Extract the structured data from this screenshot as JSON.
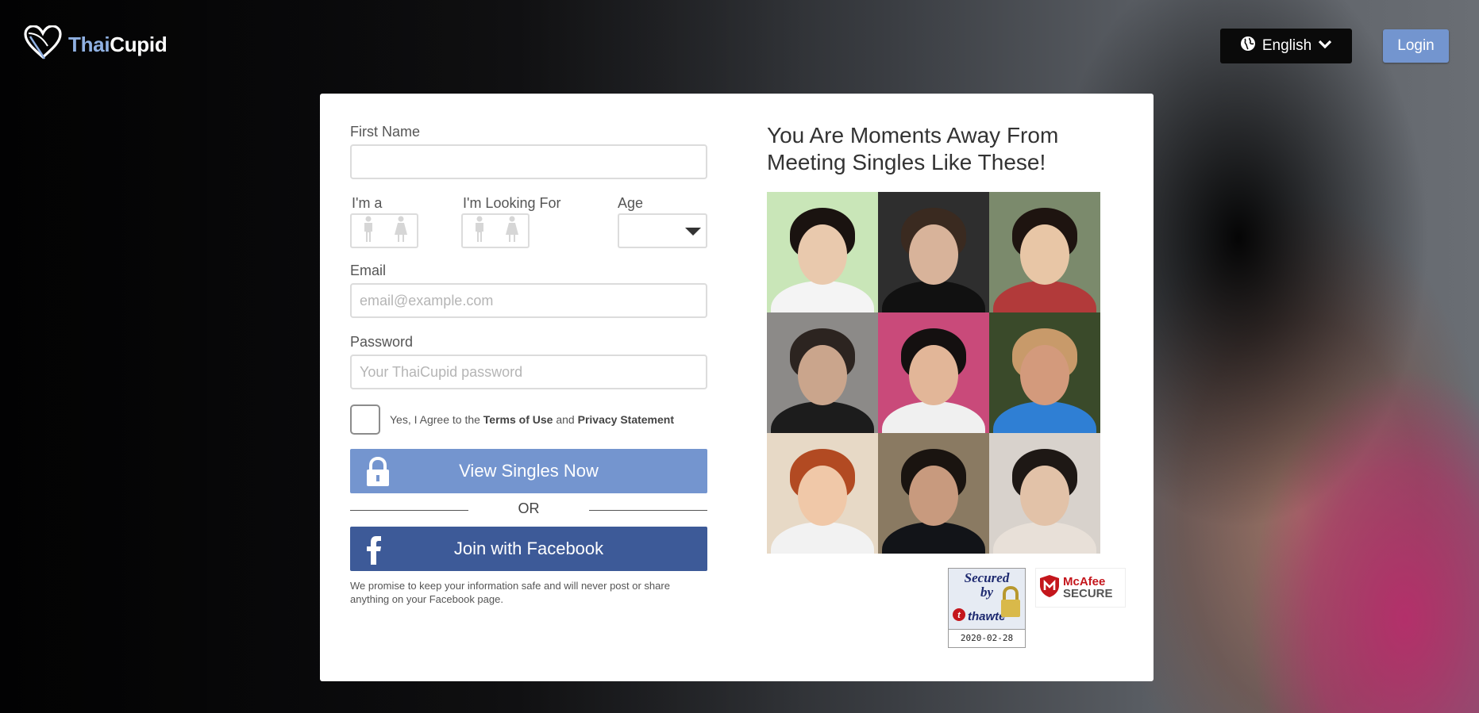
{
  "header": {
    "logo_part1": "Thai",
    "logo_part2": "Cupid",
    "language_label": "English",
    "login_label": "Login"
  },
  "form": {
    "first_name_label": "First Name",
    "first_name_value": "",
    "im_a_label": "I'm a",
    "looking_for_label": "I'm Looking For",
    "age_label": "Age",
    "age_value": "",
    "email_label": "Email",
    "email_placeholder": "email@example.com",
    "password_label": "Password",
    "password_placeholder": "Your ThaiCupid password",
    "terms_prefix": "Yes, I Agree to the ",
    "terms_link": "Terms of Use",
    "terms_and": " and ",
    "privacy_link": "Privacy Statement",
    "view_singles_label": "View Singles Now",
    "or_label": "OR",
    "facebook_label": "Join with Facebook",
    "promise_text": "We promise to keep your information safe and will never post or share anything on your Facebook page."
  },
  "promo": {
    "heading": "You Are Moments Away From Meeting Singles Like These!",
    "photos": [
      {
        "name": "profile-photo-1",
        "bg": "#c9e6b8",
        "skin": "#e9c9ad",
        "hair": "#1a1310",
        "body": "#f4f4f4"
      },
      {
        "name": "profile-photo-2",
        "bg": "#2e2e2e",
        "skin": "#d8b39a",
        "hair": "#3a2a20",
        "body": "#111111"
      },
      {
        "name": "profile-photo-3",
        "bg": "#7b8a6c",
        "skin": "#e8c6a6",
        "hair": "#1e1410",
        "body": "#b23a3a"
      },
      {
        "name": "profile-photo-4",
        "bg": "#8c8a88",
        "skin": "#caa58c",
        "hair": "#2c2420",
        "body": "#1c1c1c"
      },
      {
        "name": "profile-photo-5",
        "bg": "#c94a7a",
        "skin": "#e2b698",
        "hair": "#141010",
        "body": "#f0f0f0"
      },
      {
        "name": "profile-photo-6",
        "bg": "#3a4a2a",
        "skin": "#d39a7c",
        "hair": "#c89a6a",
        "body": "#2f7fd4"
      },
      {
        "name": "profile-photo-7",
        "bg": "#e7d9c6",
        "skin": "#f0c8a8",
        "hair": "#b24a22",
        "body": "#f2f2f2"
      },
      {
        "name": "profile-photo-8",
        "bg": "#8a7a62",
        "skin": "#c89a7e",
        "hair": "#1a1410",
        "body": "#121418"
      },
      {
        "name": "profile-photo-9",
        "bg": "#d8d2cc",
        "skin": "#e2c2a8",
        "hair": "#1e1815",
        "body": "#e8e0d8"
      }
    ]
  },
  "badges": {
    "thawte_line1": "Secured",
    "thawte_line2": "by",
    "thawte_brand": "thawte",
    "thawte_date": "2020-02-28",
    "mcafee_line1": "McAfee",
    "mcafee_line2": "SECURE"
  },
  "colors": {
    "accent_blue": "#7495cf",
    "facebook_blue": "#3d5a98",
    "mcafee_red": "#c4161c"
  }
}
